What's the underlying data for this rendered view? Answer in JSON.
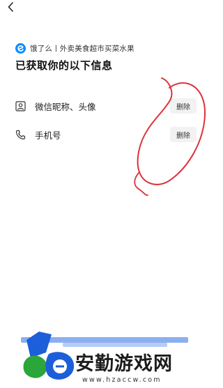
{
  "nav": {
    "back_icon": "chevron-left-icon"
  },
  "app": {
    "name": "饿了么丨外卖美食超市买菜水果",
    "logo_icon": "eleme-logo-icon",
    "brand_color": "#0a8dff"
  },
  "title": "已获取你的以下信息",
  "permissions": [
    {
      "icon": "profile-card-icon",
      "label": "微信昵称、头像",
      "action": "删除"
    },
    {
      "icon": "phone-icon",
      "label": "手机号",
      "action": "删除"
    }
  ],
  "annotation": {
    "type": "red-hand-drawn-circle",
    "color": "#e0303a"
  },
  "watermark": {
    "text": "安勤游戏网",
    "url": "www.hzaccw.com",
    "logo_icon": "site-logo-icon"
  }
}
